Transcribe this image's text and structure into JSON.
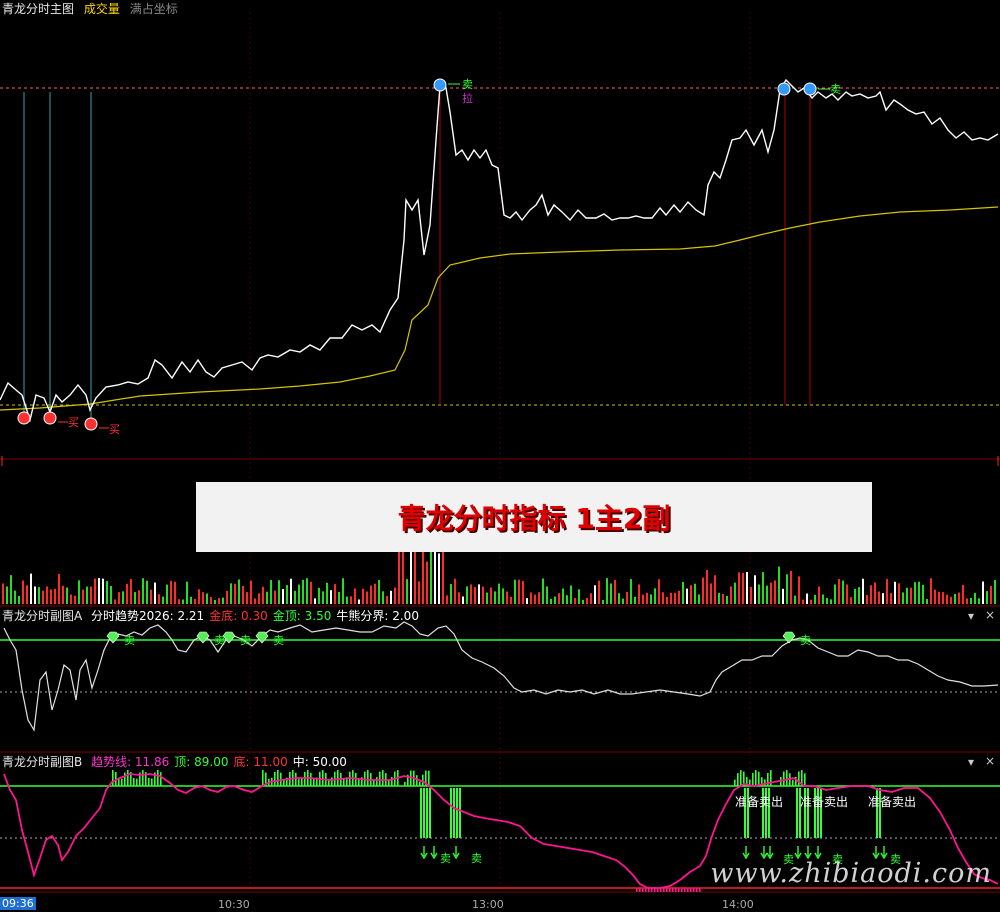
{
  "main_panel": {
    "title": "青龙分时主图",
    "tabs": [
      "成交量",
      "满占坐标"
    ],
    "signals": {
      "sell": "卖",
      "buy": "买",
      "pull": "拉"
    }
  },
  "banner_text": "青龙分时指标 1主2副",
  "sub_a": {
    "title": "青龙分时副图A",
    "items": [
      {
        "label": "分时趋势2026:",
        "value": "2.21",
        "color": "#ffffff"
      },
      {
        "label": "金底:",
        "value": "0.30",
        "color": "#ff3030"
      },
      {
        "label": "金顶:",
        "value": "3.50",
        "color": "#33ff33"
      },
      {
        "label": "牛熊分界:",
        "value": "2.00",
        "color": "#ffffff"
      }
    ],
    "sell_label": "卖"
  },
  "sub_b": {
    "title": "青龙分时副图B",
    "items": [
      {
        "label": "趋势线:",
        "value": "11.86",
        "color": "#ff33cc"
      },
      {
        "label": "顶:",
        "value": "89.00",
        "color": "#33ff33"
      },
      {
        "label": "底:",
        "value": "11.00",
        "color": "#ff3030"
      },
      {
        "label": "中:",
        "value": "50.00",
        "color": "#ffffff"
      }
    ],
    "prep_sell": "准备卖出",
    "sell_label": "卖"
  },
  "time_axis": {
    "start": "09:36",
    "ticks": [
      "10:30",
      "13:00",
      "14:00"
    ]
  },
  "controls": {
    "dropdown": "▾",
    "close": "×"
  },
  "watermark": "www.zhibiaodi.com",
  "colors": {
    "price": "#ffffff",
    "avg": "#d4c400",
    "up": "#ff2020",
    "down": "#20ff20",
    "trend_b": "#ff1493"
  }
}
